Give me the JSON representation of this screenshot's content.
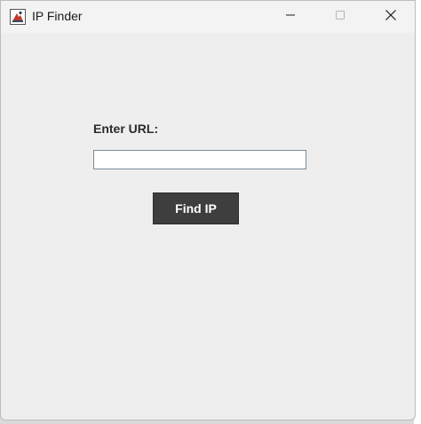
{
  "window": {
    "title": "IP Finder",
    "icon": "java-app-icon",
    "controls": {
      "minimize_icon": "minimize-icon",
      "maximize_icon": "maximize-icon",
      "close_icon": "close-icon"
    }
  },
  "form": {
    "url_label": "Enter URL:",
    "url_value": "",
    "url_placeholder": "",
    "find_button_label": "Find IP"
  },
  "colors": {
    "window_background": "#eeeeee",
    "button_background": "#3e3e3e",
    "button_text": "#ffffff"
  }
}
